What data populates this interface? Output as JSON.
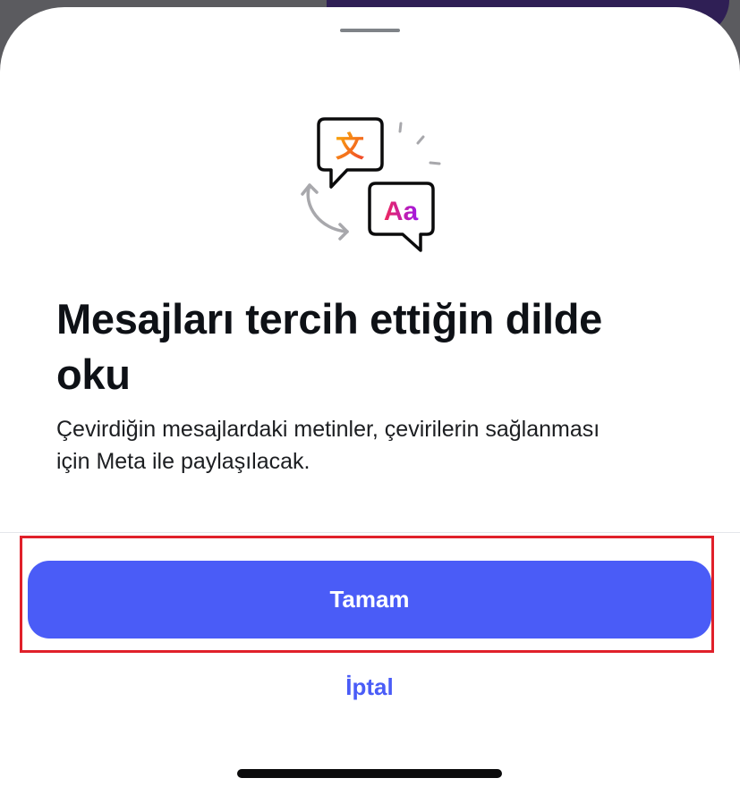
{
  "sheet": {
    "title": "Mesajları tercih ettiğin dilde oku",
    "description": "Çevirdiğin mesajlardaki metinler, çevirilerin sağlanması için Meta ile paylaşılacak.",
    "illustration": {
      "icon": "translate-icon",
      "source_glyph": "文",
      "target_glyph": "Aa"
    }
  },
  "actions": {
    "ok_label": "Tamam",
    "cancel_label": "İptal"
  },
  "colors": {
    "accent": "#4a5cf7",
    "highlight_outline": "#e0202a",
    "title": "#0e1116"
  }
}
